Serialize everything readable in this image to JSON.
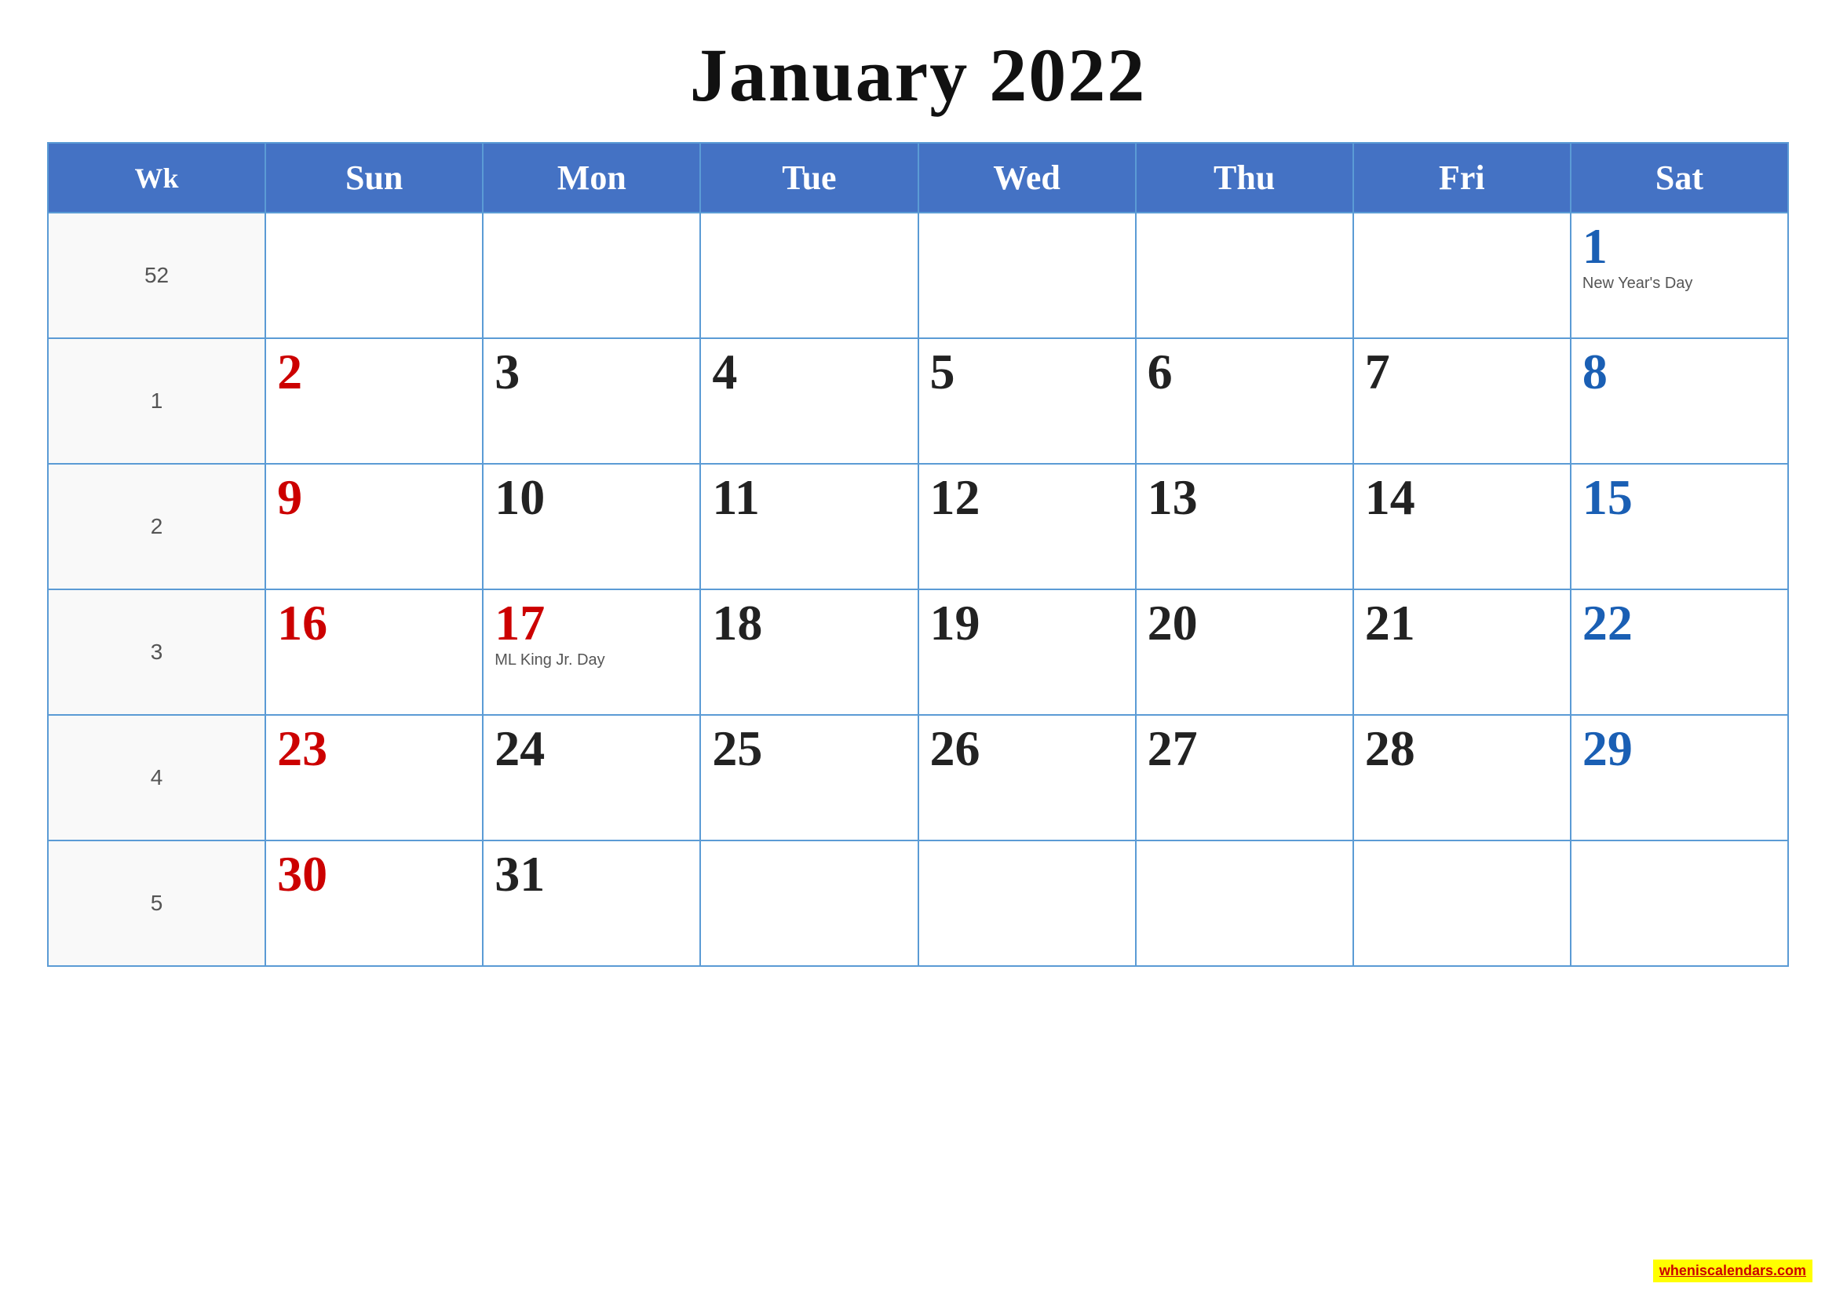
{
  "title": "January 2022",
  "header": {
    "wk": "Wk",
    "days": [
      "Sun",
      "Mon",
      "Tue",
      "Wed",
      "Thu",
      "Fri",
      "Sat"
    ]
  },
  "weeks": [
    {
      "wk": "52",
      "days": [
        {
          "num": "",
          "type": "empty"
        },
        {
          "num": "",
          "type": "empty"
        },
        {
          "num": "",
          "type": "empty"
        },
        {
          "num": "",
          "type": "empty"
        },
        {
          "num": "",
          "type": "empty"
        },
        {
          "num": "",
          "type": "empty"
        },
        {
          "num": "1",
          "type": "saturday",
          "holiday": "New Year's Day"
        }
      ]
    },
    {
      "wk": "1",
      "days": [
        {
          "num": "2",
          "type": "sunday"
        },
        {
          "num": "3",
          "type": "weekday"
        },
        {
          "num": "4",
          "type": "weekday"
        },
        {
          "num": "5",
          "type": "weekday"
        },
        {
          "num": "6",
          "type": "weekday"
        },
        {
          "num": "7",
          "type": "weekday"
        },
        {
          "num": "8",
          "type": "saturday"
        }
      ]
    },
    {
      "wk": "2",
      "days": [
        {
          "num": "9",
          "type": "sunday"
        },
        {
          "num": "10",
          "type": "weekday"
        },
        {
          "num": "11",
          "type": "weekday"
        },
        {
          "num": "12",
          "type": "weekday"
        },
        {
          "num": "13",
          "type": "weekday"
        },
        {
          "num": "14",
          "type": "weekday"
        },
        {
          "num": "15",
          "type": "saturday"
        }
      ]
    },
    {
      "wk": "3",
      "days": [
        {
          "num": "16",
          "type": "sunday"
        },
        {
          "num": "17",
          "type": "holiday-red",
          "holiday": "ML King Jr. Day"
        },
        {
          "num": "18",
          "type": "weekday"
        },
        {
          "num": "19",
          "type": "weekday"
        },
        {
          "num": "20",
          "type": "weekday"
        },
        {
          "num": "21",
          "type": "weekday"
        },
        {
          "num": "22",
          "type": "saturday"
        }
      ]
    },
    {
      "wk": "4",
      "days": [
        {
          "num": "23",
          "type": "sunday"
        },
        {
          "num": "24",
          "type": "weekday"
        },
        {
          "num": "25",
          "type": "weekday"
        },
        {
          "num": "26",
          "type": "weekday"
        },
        {
          "num": "27",
          "type": "weekday"
        },
        {
          "num": "28",
          "type": "weekday"
        },
        {
          "num": "29",
          "type": "saturday"
        }
      ]
    },
    {
      "wk": "5",
      "days": [
        {
          "num": "30",
          "type": "sunday"
        },
        {
          "num": "31",
          "type": "weekday"
        },
        {
          "num": "",
          "type": "empty"
        },
        {
          "num": "",
          "type": "empty"
        },
        {
          "num": "",
          "type": "empty"
        },
        {
          "num": "",
          "type": "empty"
        },
        {
          "num": "",
          "type": "empty"
        }
      ]
    }
  ],
  "watermark": {
    "text": "wheniscalendars.com",
    "url": "#"
  }
}
